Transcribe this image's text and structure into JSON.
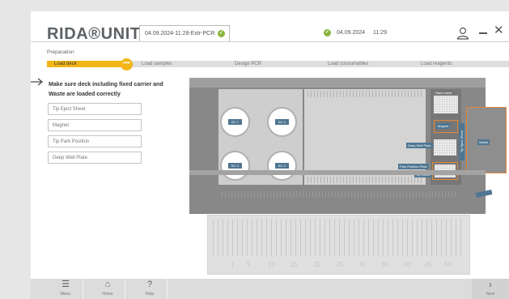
{
  "header": {
    "logo": "RIDA®UNITY",
    "run_tab": "04.09.2024-11:28-Extr-PCR",
    "date": "04.09.2024",
    "time": "11:29"
  },
  "section": "Preparation",
  "steps": [
    {
      "label": "Load deck",
      "active": true
    },
    {
      "label": "Load samples",
      "active": false
    },
    {
      "label": "Design PCR",
      "active": false
    },
    {
      "label": "Load consumables",
      "active": false
    },
    {
      "label": "Load reagents",
      "active": false
    }
  ],
  "step_indicator": "•••",
  "instruction": "Make sure deck including fixed carrier and Waste are loaded correctly",
  "options": [
    "Tip Eject Sheet",
    "Magnet",
    "Tip Park Position",
    "Deep Well Plate"
  ],
  "deck": {
    "wells": [
      "BC 1",
      "BC 4",
      "BC 3",
      "BC 2"
    ],
    "labels": {
      "magnet": "Magnet",
      "deep_well_plate": "Deep Well Plate",
      "park_position_plate": "Park Position Plate",
      "tip_stand": "Tip Stand",
      "tip_eject": "Tip Eject Sheet",
      "waste": "Waste",
      "rack_top": "Rack name"
    },
    "numbers": [
      "1",
      "5",
      "10",
      "15",
      "20",
      "25",
      "30",
      "35",
      "40",
      "45",
      "50"
    ]
  },
  "footer": {
    "menu": "Menu",
    "home": "Home",
    "help": "Help",
    "next": "Next"
  },
  "colors": {
    "accent": "#f2b516",
    "ok_green": "#8bb53f",
    "label_blue": "#4f7691",
    "highlight_orange": "#e0893b"
  }
}
